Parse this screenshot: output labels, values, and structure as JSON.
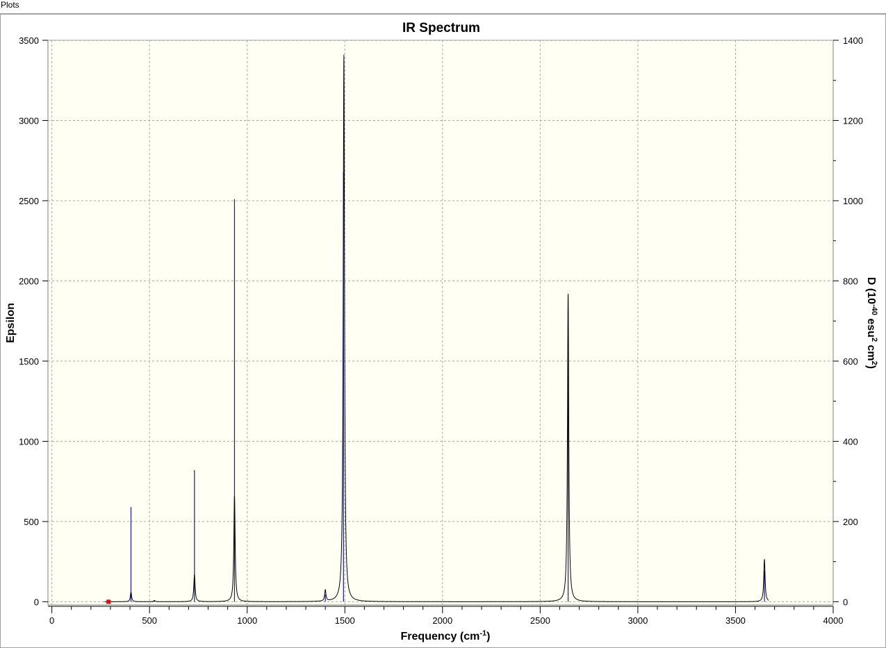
{
  "window": {
    "title": "Plots"
  },
  "colors": {
    "plot_background": "#fffff4",
    "curve": "#000000",
    "stick": "#1a1a8c",
    "grid": "#a8a8a8",
    "marker": "#e01010"
  },
  "chart_data": {
    "type": "line",
    "title": "IR Spectrum",
    "xlabel": {
      "main": "Frequency (cm",
      "sup": "-1",
      "end": ")"
    },
    "ylabel_left": "Epsilon",
    "ylabel_right": {
      "prefix": "D (10",
      "sup1": "-40",
      "mid": " esu",
      "sup2": "2",
      "mid2": " cm",
      "sup3": "2",
      "end": ")"
    },
    "xlim": [
      -20,
      4000
    ],
    "ylim_left": [
      -20,
      3500
    ],
    "ylim_right": [
      -8,
      1400
    ],
    "grid": true,
    "x_ticks": [
      "0",
      "500",
      "1000",
      "1500",
      "2000",
      "2500",
      "3000",
      "3500",
      "4000"
    ],
    "y_left_ticks": [
      "0",
      "500",
      "1000",
      "1500",
      "2000",
      "2500",
      "3000",
      "3500"
    ],
    "y_right_ticks": [
      "0",
      "200",
      "400",
      "600",
      "800",
      "1000",
      "1200",
      "1400"
    ],
    "spectrum_series": {
      "name": "Epsilon",
      "peaks": [
        {
          "freq": 405,
          "epsilon": 60
        },
        {
          "freq": 525,
          "epsilon": 8
        },
        {
          "freq": 730,
          "epsilon": 170
        },
        {
          "freq": 935,
          "epsilon": 660
        },
        {
          "freq": 1400,
          "epsilon": 70
        },
        {
          "freq": 1495,
          "epsilon": 3410
        },
        {
          "freq": 2643,
          "epsilon": 1920
        },
        {
          "freq": 3648,
          "epsilon": 265
        }
      ]
    },
    "sticks_series": {
      "name": "D (10^-40 esu^2 cm^2)",
      "values": [
        {
          "freq": 405,
          "D": 236
        },
        {
          "freq": 525,
          "D": 3
        },
        {
          "freq": 730,
          "D": 328
        },
        {
          "freq": 935,
          "D": 1004
        },
        {
          "freq": 1400,
          "D": 18
        },
        {
          "freq": 1493,
          "D": 1072
        },
        {
          "freq": 2643,
          "D": 640
        },
        {
          "freq": 3648,
          "D": 78
        }
      ]
    },
    "marker_freq": 290
  }
}
